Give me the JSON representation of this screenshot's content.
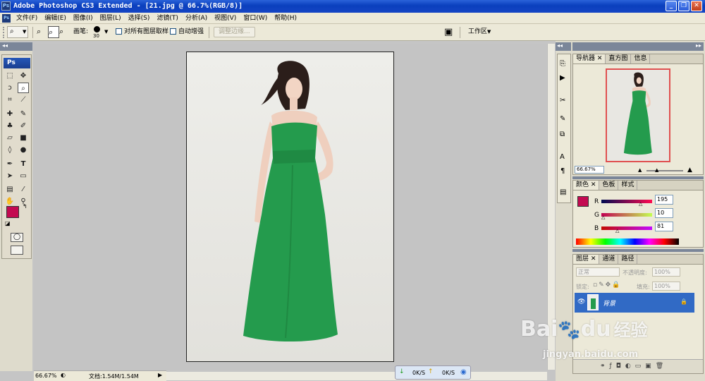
{
  "title": "Adobe Photoshop CS3 Extended - [21.jpg @ 66.7%(RGB/8)]",
  "app_badge": "Ps",
  "menu": [
    "文件(F)",
    "编辑(E)",
    "图像(I)",
    "图层(L)",
    "选择(S)",
    "滤镜(T)",
    "分析(A)",
    "视图(V)",
    "窗口(W)",
    "帮助(H)"
  ],
  "options": {
    "brush_label": "画笔:",
    "brush_size": "30",
    "sample_all_layers": "对所有图层取样",
    "auto_enhance": "自动增强",
    "refine_edge": "调整边缘...",
    "workspace": "工作区"
  },
  "toolbox": {
    "logo": "Ps"
  },
  "status": {
    "zoom": "66.67%",
    "doc": "文档:1.54M/1.54M"
  },
  "netmeter": {
    "down": "0K/S",
    "up": "0K/S"
  },
  "navigator": {
    "tabs": [
      "导航器",
      "直方图",
      "信息"
    ],
    "zoom": "66.67%"
  },
  "color": {
    "tabs": [
      "颜色",
      "色板",
      "样式"
    ],
    "r_label": "R",
    "g_label": "G",
    "b_label": "B",
    "r": "195",
    "g": "10",
    "b": "81",
    "fg": "#c30a51"
  },
  "layers": {
    "tabs": [
      "图层",
      "通道",
      "路径"
    ],
    "blend_mode": "正常",
    "opacity_label": "不透明度:",
    "opacity": "100%",
    "lock_label": "锁定:",
    "fill_label": "填充:",
    "fill": "100%",
    "layer_name": "背景"
  },
  "watermark": {
    "brand": "Bai",
    "brand2": "du",
    "cn": "经验",
    "url": "jingyan.baidu.com"
  }
}
